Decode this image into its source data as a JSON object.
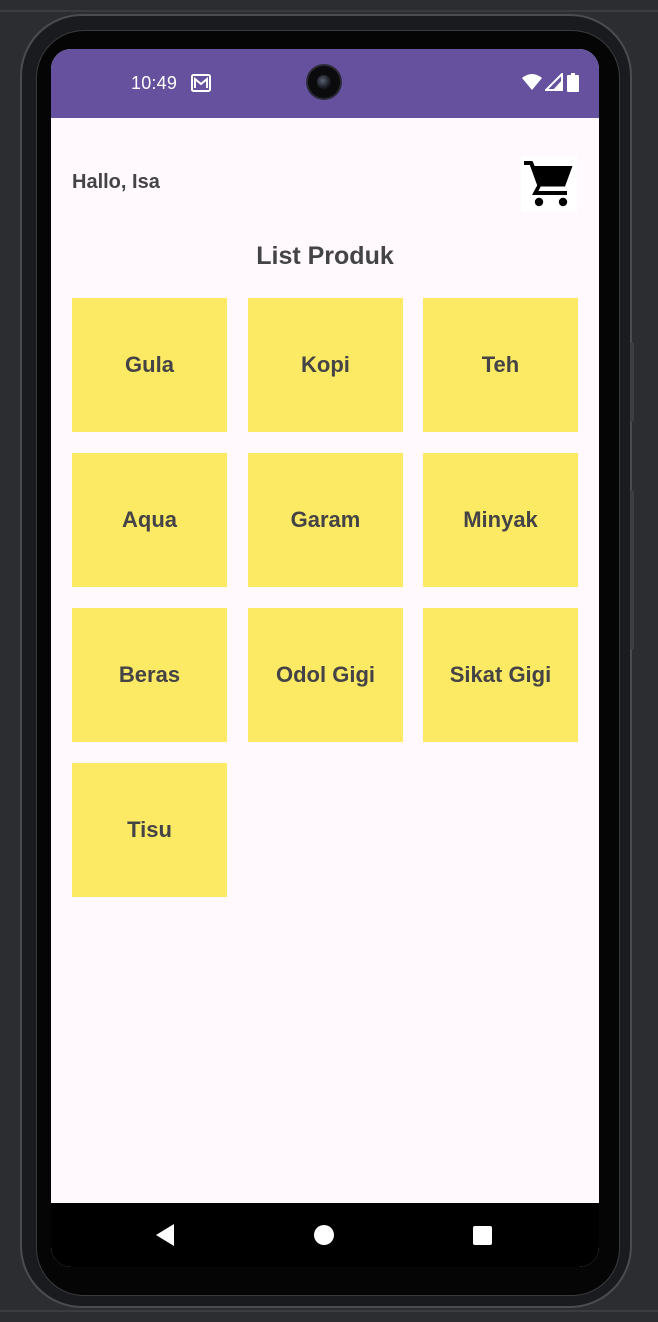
{
  "status_bar": {
    "time": "10:49",
    "notification_icon": "gmail-icon",
    "icons": [
      "wifi-icon",
      "signal-icon",
      "battery-icon"
    ],
    "color": "#65519e"
  },
  "header": {
    "greeting": "Hallo, Isa",
    "cart_icon": "shopping-cart-icon"
  },
  "main": {
    "title": "List Produk",
    "card_color": "#fce964",
    "products": [
      {
        "label": "Gula"
      },
      {
        "label": "Kopi"
      },
      {
        "label": "Teh"
      },
      {
        "label": "Aqua"
      },
      {
        "label": "Garam"
      },
      {
        "label": "Minyak"
      },
      {
        "label": "Beras"
      },
      {
        "label": "Odol Gigi"
      },
      {
        "label": "Sikat Gigi"
      },
      {
        "label": "Tisu"
      }
    ]
  },
  "nav_bar": {
    "buttons": [
      "back-icon",
      "home-icon",
      "recents-icon"
    ]
  }
}
